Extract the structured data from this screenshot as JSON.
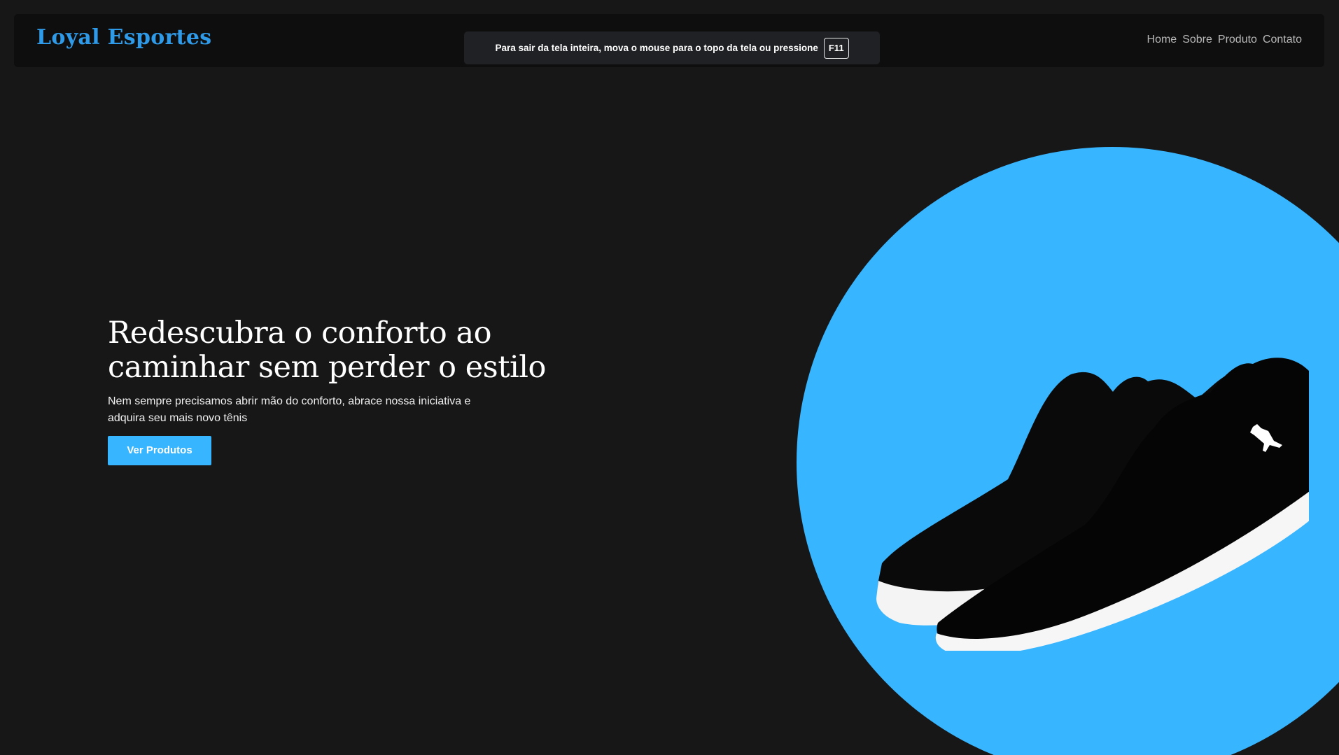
{
  "brand": {
    "name": "Loyal Esportes",
    "color": "#2f9be8"
  },
  "nav": {
    "items": [
      {
        "label": "Home"
      },
      {
        "label": "Sobre"
      },
      {
        "label": "Produto"
      },
      {
        "label": "Contato"
      }
    ]
  },
  "fullscreen_notice": {
    "message": "Para sair da tela inteira, mova o mouse para o topo da tela ou pressione",
    "key": "F11"
  },
  "hero": {
    "title": "Redescubra o conforto ao caminhar sem perder o estilo",
    "description": "Nem sempre precisamos abrir mão do conforto, abrace nossa iniciativa e adquira seu mais novo tênis",
    "cta_label": "Ver Produtos",
    "image": "black-sneakers-pair",
    "accent_color": "#38b5ff"
  },
  "theme": {
    "background": "#171718",
    "navbar_background": "#0e0e0f"
  }
}
